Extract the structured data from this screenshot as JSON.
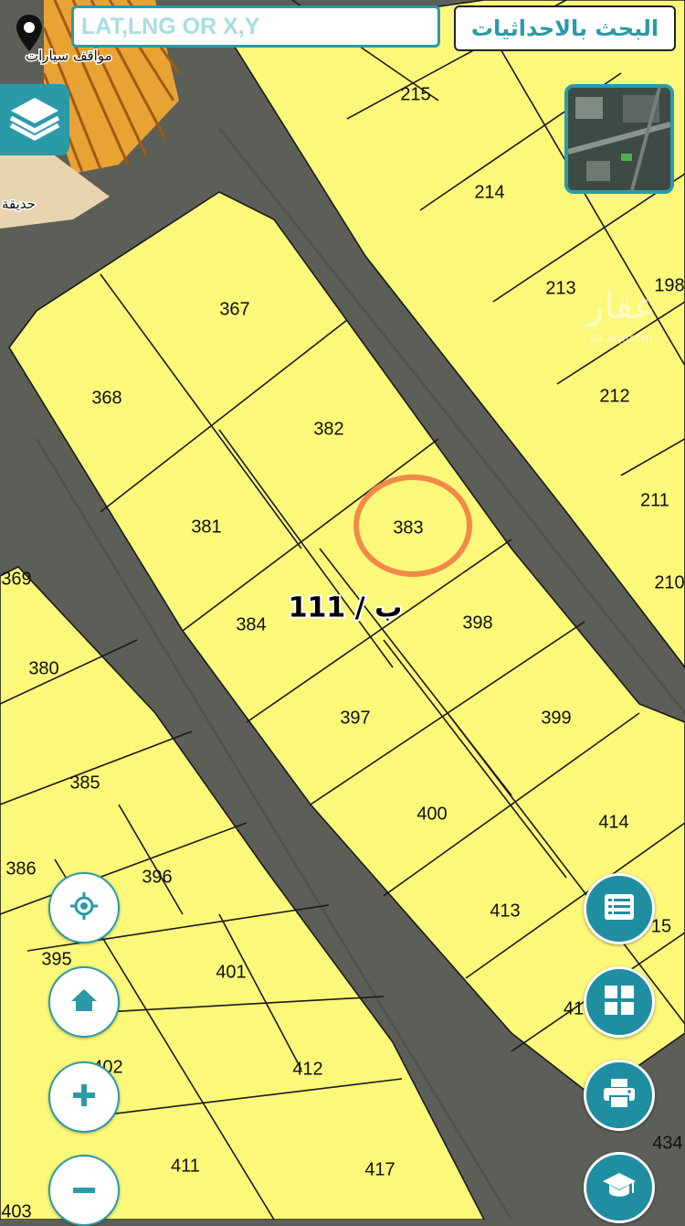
{
  "search": {
    "placeholder": "LAT,LNG OR X,Y",
    "button_label": "البحث بالاحداثيات"
  },
  "map": {
    "block_label": "ب / 111",
    "selected_plot": "383",
    "poi_labels": [
      "مواقف سيارات",
      "حديقة"
    ],
    "plots": [
      {
        "id": "215"
      },
      {
        "id": "214"
      },
      {
        "id": "213"
      },
      {
        "id": "198"
      },
      {
        "id": "212"
      },
      {
        "id": "211"
      },
      {
        "id": "210"
      },
      {
        "id": "367"
      },
      {
        "id": "368"
      },
      {
        "id": "382"
      },
      {
        "id": "381"
      },
      {
        "id": "383"
      },
      {
        "id": "384"
      },
      {
        "id": "398"
      },
      {
        "id": "397"
      },
      {
        "id": "399"
      },
      {
        "id": "400"
      },
      {
        "id": "414"
      },
      {
        "id": "413"
      },
      {
        "id": "15"
      },
      {
        "id": "41"
      },
      {
        "id": "369"
      },
      {
        "id": "380"
      },
      {
        "id": "385"
      },
      {
        "id": "386"
      },
      {
        "id": "396"
      },
      {
        "id": "395"
      },
      {
        "id": "401"
      },
      {
        "id": "402"
      },
      {
        "id": "412"
      },
      {
        "id": "411"
      },
      {
        "id": "417"
      },
      {
        "id": "434"
      },
      {
        "id": "403"
      }
    ]
  },
  "watermark": {
    "brand": "عقار",
    "site": "sa.aqar.fm"
  },
  "colors": {
    "accent": "#2a9aa8",
    "plot_fill": "#fbf87a",
    "selection_ring": "#f0894a",
    "road": "#5b5f57"
  },
  "controls": {
    "pin": "map-pin-icon",
    "layers": "layers-icon",
    "locate": "locate-icon",
    "home": "home-icon",
    "zoom_in": "plus-icon",
    "zoom_out": "minus-icon",
    "list": "list-icon",
    "grid": "grid-icon",
    "print": "printer-icon",
    "education": "graduation-cap-icon"
  }
}
